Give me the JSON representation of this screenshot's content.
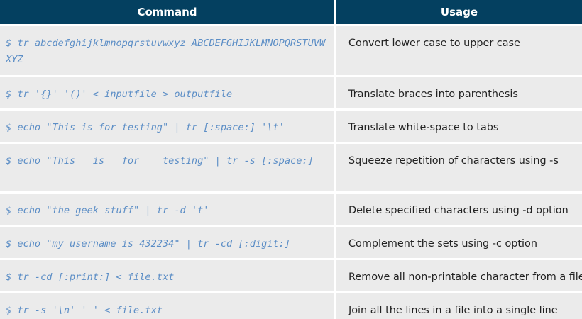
{
  "table": {
    "headers": {
      "command": "Command",
      "usage": "Usage"
    },
    "rows": [
      {
        "command": "$ tr abcdefghijklmnopqrstuvwxyz ABCDEFGHIJKLMNOPQRSTUVWXYZ",
        "usage": "Convert lower case to upper case"
      },
      {
        "command": "$ tr '{}' '()' < inputfile > outputfile",
        "usage": "Translate braces into parenthesis"
      },
      {
        "command": "$ echo \"This is for testing\" | tr [:space:] '\\t'",
        "usage": "Translate white-space to tabs"
      },
      {
        "command": "$ echo \"This   is   for    testing\" | tr -s [:space:]",
        "usage": "Squeeze repetition of characters using -s"
      },
      {
        "command": "$ echo \"the geek stuff\" | tr -d 't'",
        "usage": "Delete specified characters using -d option"
      },
      {
        "command": "$ echo \"my username is 432234\" | tr -cd [:digit:]",
        "usage": "Complement the sets using -c option"
      },
      {
        "command": "$ tr -cd [:print:] < file.txt",
        "usage": "Remove all non-printable character from a file"
      },
      {
        "command": "$ tr -s '\\n' ' ' < file.txt",
        "usage": "Join all the lines in a file into a single line"
      }
    ]
  },
  "colors": {
    "header_bg": "#044060",
    "row_bg": "#ebebeb",
    "command_text": "#5c8ec6",
    "usage_text": "#222222"
  }
}
